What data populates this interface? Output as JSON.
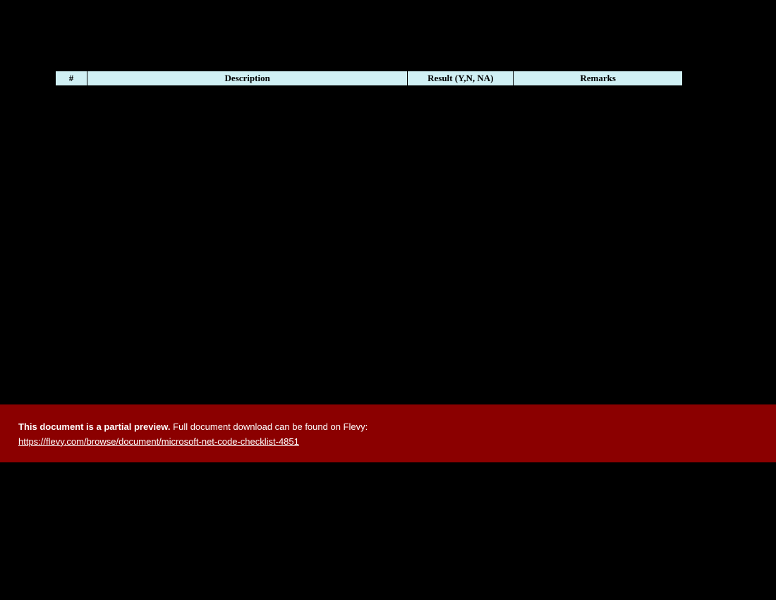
{
  "table": {
    "headers": {
      "num": "#",
      "description": "Description",
      "result": "Result (Y,N, NA)",
      "remarks": "Remarks"
    }
  },
  "banner": {
    "bold_text": "This document is a partial preview.",
    "rest_text": "  Full document download can be found on Flevy:",
    "link_text": "https://flevy.com/browse/document/microsoft-net-code-checklist-4851"
  }
}
